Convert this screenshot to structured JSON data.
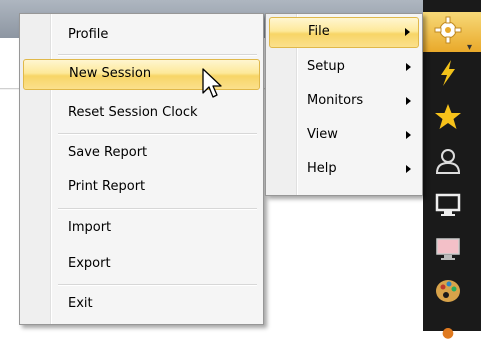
{
  "main_menu": {
    "items": [
      {
        "label": "Profile"
      },
      {
        "label": "New Session"
      },
      {
        "label": "Reset Session Clock"
      },
      {
        "label": "Save Report"
      },
      {
        "label": "Print Report"
      },
      {
        "label": "Import"
      },
      {
        "label": "Export"
      },
      {
        "label": "Exit"
      }
    ]
  },
  "top_menu": {
    "items": [
      {
        "label": "File"
      },
      {
        "label": "Setup"
      },
      {
        "label": "Monitors"
      },
      {
        "label": "View"
      },
      {
        "label": "Help"
      }
    ]
  },
  "toolbar": {
    "icons": [
      "gear-icon",
      "lightning-icon",
      "star-icon",
      "user-icon",
      "monitor-icon",
      "display-icon",
      "palette-icon"
    ]
  },
  "colors": {
    "highlight": "#f7d567",
    "toolbar_bg": "#1a1a1a",
    "toolbar_active": "#e9a92a"
  }
}
